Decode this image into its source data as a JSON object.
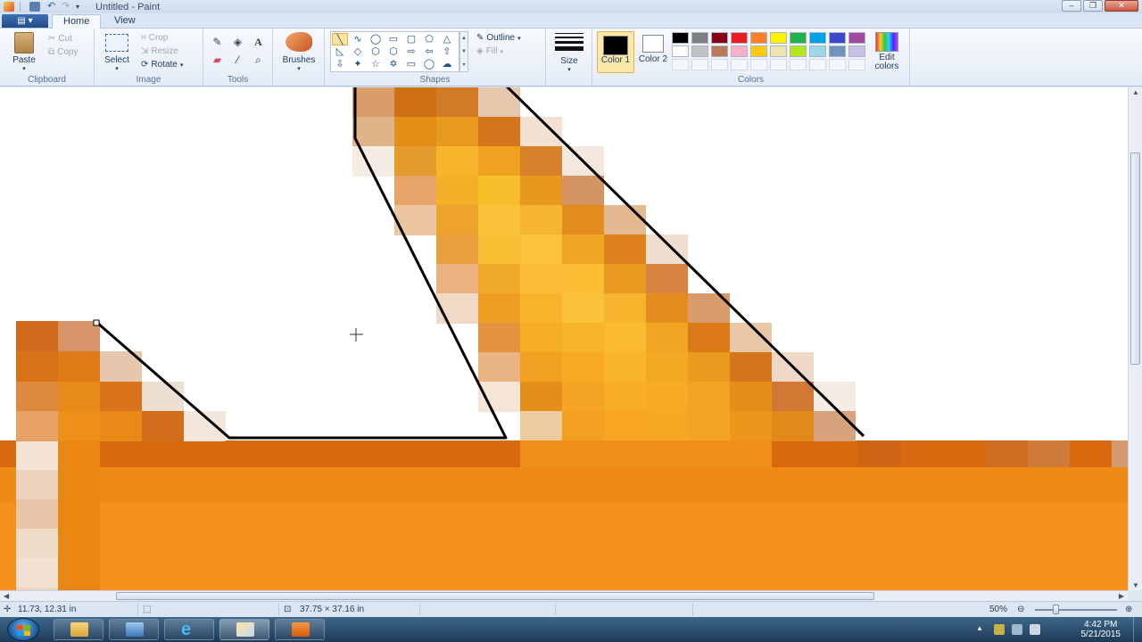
{
  "window": {
    "title": "Untitled - Paint"
  },
  "tabs": {
    "file": "",
    "home": "Home",
    "view": "View"
  },
  "ribbon": {
    "clipboard": {
      "label": "Clipboard",
      "paste": "Paste",
      "cut": "Cut",
      "copy": "Copy"
    },
    "image": {
      "label": "Image",
      "select": "Select",
      "crop": "Crop",
      "resize": "Resize",
      "rotate": "Rotate"
    },
    "tools": {
      "label": "Tools",
      "icons": [
        "pencil-icon",
        "fill-icon",
        "text-icon",
        "eraser-icon",
        "color-picker-icon",
        "magnifier-icon"
      ]
    },
    "brushes": {
      "label": "Brushes"
    },
    "shapes": {
      "label": "Shapes",
      "outline": "Outline",
      "fill": "Fill"
    },
    "size": {
      "label": "Size"
    },
    "colors": {
      "label": "Colors",
      "color1": "Color 1",
      "color2": "Color 2",
      "edit": "Edit colors",
      "palette_row1": [
        "#000000",
        "#7f7f7f",
        "#880015",
        "#ed1c24",
        "#ff7f27",
        "#fff200",
        "#22b14c",
        "#00a2e8",
        "#3f48cc",
        "#a349a4"
      ],
      "palette_row2": [
        "#ffffff",
        "#c3c3c3",
        "#b97a57",
        "#ffaec9",
        "#ffc90e",
        "#efe4b0",
        "#b5e61d",
        "#99d9ea",
        "#7092be",
        "#c8bfe7"
      ]
    }
  },
  "status": {
    "cursor_position": "11.73, 12.31 in",
    "selection_size": "",
    "image_size": "37.75 × 37.16 in",
    "zoom": "50%"
  },
  "taskbar": {
    "time": "4:42 PM",
    "date": "5/21/2015"
  },
  "accent": "#1e395b"
}
